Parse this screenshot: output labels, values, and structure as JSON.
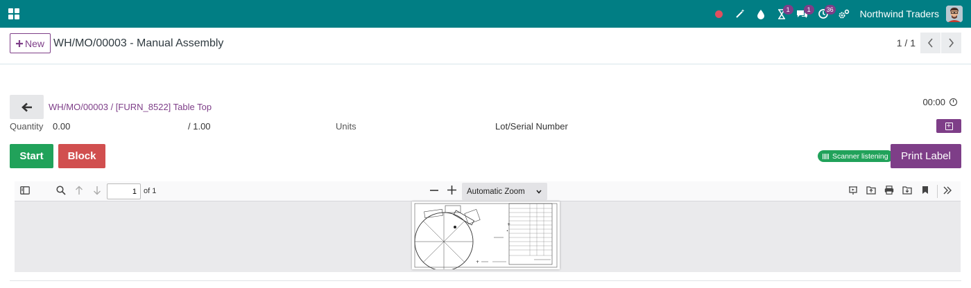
{
  "navbar": {
    "company": "Northwind Traders",
    "activity_badge": "1",
    "messages_badge": "1",
    "updates_badge": "36",
    "colors": {
      "brand": "#017e84",
      "accent": "#7e3e88"
    }
  },
  "control_panel": {
    "new_label": "New",
    "title": "WH/MO/00003 - Manual Assembly",
    "pager": "1 / 1"
  },
  "workorder": {
    "link": "WH/MO/00003 / [FURN_8522] Table Top",
    "timer": "00:00",
    "quantity_label": "Quantity",
    "quantity_done": "0.00",
    "quantity_total": "/ 1.00",
    "uom": "Units",
    "lot_label": "Lot/Serial Number",
    "start_label": "Start",
    "block_label": "Block",
    "scanner_label": "Scanner listening",
    "print_label": "Print Label"
  },
  "pdf": {
    "page_number": "1",
    "page_count": "of 1",
    "zoom": "Automatic Zoom"
  }
}
